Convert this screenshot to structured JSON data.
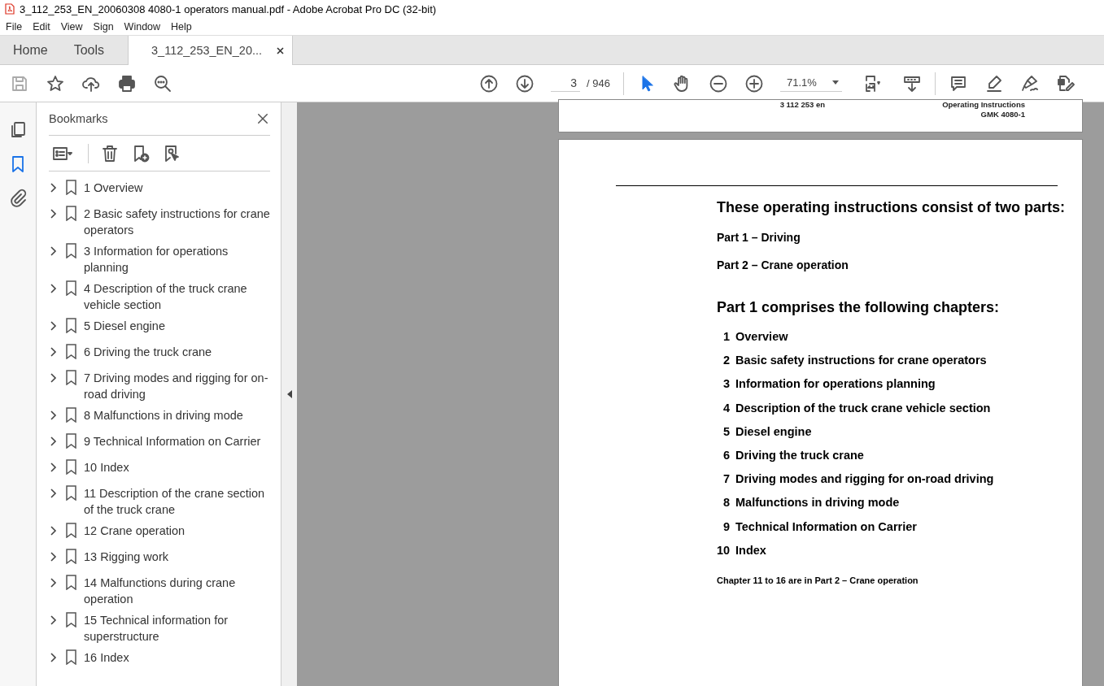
{
  "window": {
    "title": "3_112_253_EN_20060308  4080-1 operators manual.pdf - Adobe Acrobat Pro DC (32-bit)"
  },
  "menu": [
    "File",
    "Edit",
    "View",
    "Sign",
    "Window",
    "Help"
  ],
  "tabs": [
    {
      "label": "Home",
      "selected": false
    },
    {
      "label": "Tools",
      "selected": false
    },
    {
      "label": "3_112_253_EN_20...",
      "selected": true,
      "closable": true
    }
  ],
  "toolbar": {
    "page": "3",
    "pages": "/ 946",
    "zoom": "71.1%"
  },
  "sidebar": {
    "title": "Bookmarks",
    "items": [
      {
        "label": "1 Overview",
        "expanded": false
      },
      {
        "label": "2 Basic safety instructions for crane operators",
        "expanded": false
      },
      {
        "label": "3 Information for operations planning",
        "expanded": false
      },
      {
        "label": "4 Description of the truck crane vehicle section",
        "expanded": false
      },
      {
        "label": "5 Diesel engine",
        "expanded": false
      },
      {
        "label": "6 Driving the truck crane",
        "expanded": false
      },
      {
        "label": "7 Driving modes and rigging for on-road driving",
        "expanded": false
      },
      {
        "label": "8 Malfunctions in driving mode",
        "expanded": false
      },
      {
        "label": "9 Technical Information on Carrier",
        "expanded": false
      },
      {
        "label": "10 Index",
        "expanded": false
      },
      {
        "label": "11 Description of the crane section of the truck crane",
        "expanded": false
      },
      {
        "label": "12 Crane operation",
        "expanded": false
      },
      {
        "label": "13 Rigging work",
        "expanded": false
      },
      {
        "label": "14 Malfunctions during crane operation",
        "expanded": false
      },
      {
        "label": "15 Technical information for superstructure",
        "expanded": false
      },
      {
        "label": "16 Index",
        "expanded": false
      }
    ]
  },
  "document": {
    "previous_page_footer": {
      "number": "3 112 253 en",
      "title": "Operating Instructions",
      "model": "GMK 4080-1"
    },
    "heading": "These operating instructions consist of two parts:",
    "parts": [
      "Part 1 – Driving",
      "Part 2 – Crane operation"
    ],
    "subheading": "Part 1 comprises the following chapters:",
    "chapters": [
      {
        "number": "1",
        "title": "Overview"
      },
      {
        "number": "2",
        "title": "Basic safety instructions for crane operators"
      },
      {
        "number": "3",
        "title": "Information for operations planning"
      },
      {
        "number": "4",
        "title": "Description of the truck crane vehicle section"
      },
      {
        "number": "5",
        "title": "Diesel engine"
      },
      {
        "number": "6",
        "title": "Driving the truck crane"
      },
      {
        "number": "7",
        "title": "Driving modes and rigging for on-road driving"
      },
      {
        "number": "8",
        "title": "Malfunctions in driving mode"
      },
      {
        "number": "9",
        "title": "Technical Information on Carrier"
      },
      {
        "number": "10",
        "title": "Index"
      }
    ],
    "note": "Chapter 11 to 16 are in Part 2 – Crane operation"
  }
}
